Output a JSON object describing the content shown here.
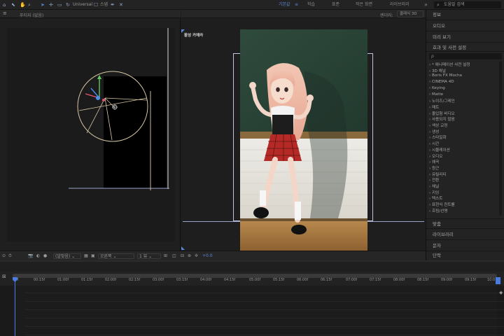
{
  "toolbar": {
    "tools": [
      "⛶",
      "✋",
      "🔍",
      "↻",
      "⟲",
      "⊕",
      "✒",
      "T",
      "✎",
      "⬚",
      "◈",
      "✦"
    ],
    "universal_label": "Universal",
    "snap_label": "스냅",
    "workspaces": [
      {
        "label": "기본값",
        "active": true
      },
      {
        "label": "≡",
        "active": false
      },
      {
        "label": "학습",
        "active": false
      },
      {
        "label": "표준",
        "active": false
      },
      {
        "label": "작은 화면",
        "active": false
      },
      {
        "label": "라이브러리",
        "active": false
      }
    ],
    "more_label": "»",
    "search_placeholder": "도움말 검색"
  },
  "left_panel": {
    "tab_label": "푸티지 (없음)"
  },
  "center_panel": {
    "renderer_label": "렌더러:",
    "renderer_value": "클래식 3D",
    "comp_label": "활성 카메라"
  },
  "right_panel": {
    "sections": [
      "정보",
      "오디오",
      "미리 보기",
      "효과 및 사전 설정"
    ],
    "search_placeholder": "ρ",
    "effects": [
      "* 애니메이션 사전 설정",
      "3D 채널",
      "Boris FX Mocha",
      "CINEMA 4D",
      "Keying",
      "Matte",
      "노이즈/그레인",
      "매트",
      "몰입형 비디오",
      "사용되지 않음",
      "색상 교정",
      "생성",
      "스타일화",
      "시간",
      "시뮬레이션",
      "오디오",
      "왜곡",
      "원근",
      "유틸리티",
      "전환",
      "채널",
      "키잉",
      "텍스트",
      "표현식 컨트롤",
      "흐림/선명"
    ],
    "bottom_sections": [
      "맞춤",
      "라이브러리",
      "문자",
      "단락"
    ]
  },
  "viewer_status": {
    "zoom_value": "(알맞음)",
    "view_value": "오른쪽",
    "views_value": "1 뷰",
    "exposure_value": "+0.0"
  },
  "timeline": {
    "ticks": [
      "00f",
      "00:15f",
      "01:00f",
      "01:15f",
      "02:00f",
      "02:15f",
      "03:00f",
      "03:15f",
      "04:00f",
      "04:15f",
      "05:00f",
      "05:15f",
      "06:00f",
      "06:15f",
      "07:00f",
      "07:15f",
      "08:00f",
      "08:15f",
      "09:00f",
      "09:15f",
      "10:0"
    ]
  },
  "colors": {
    "accent": "#5b86d6",
    "panel_bg": "#232323",
    "viewer_bg": "#1b1b1b"
  }
}
